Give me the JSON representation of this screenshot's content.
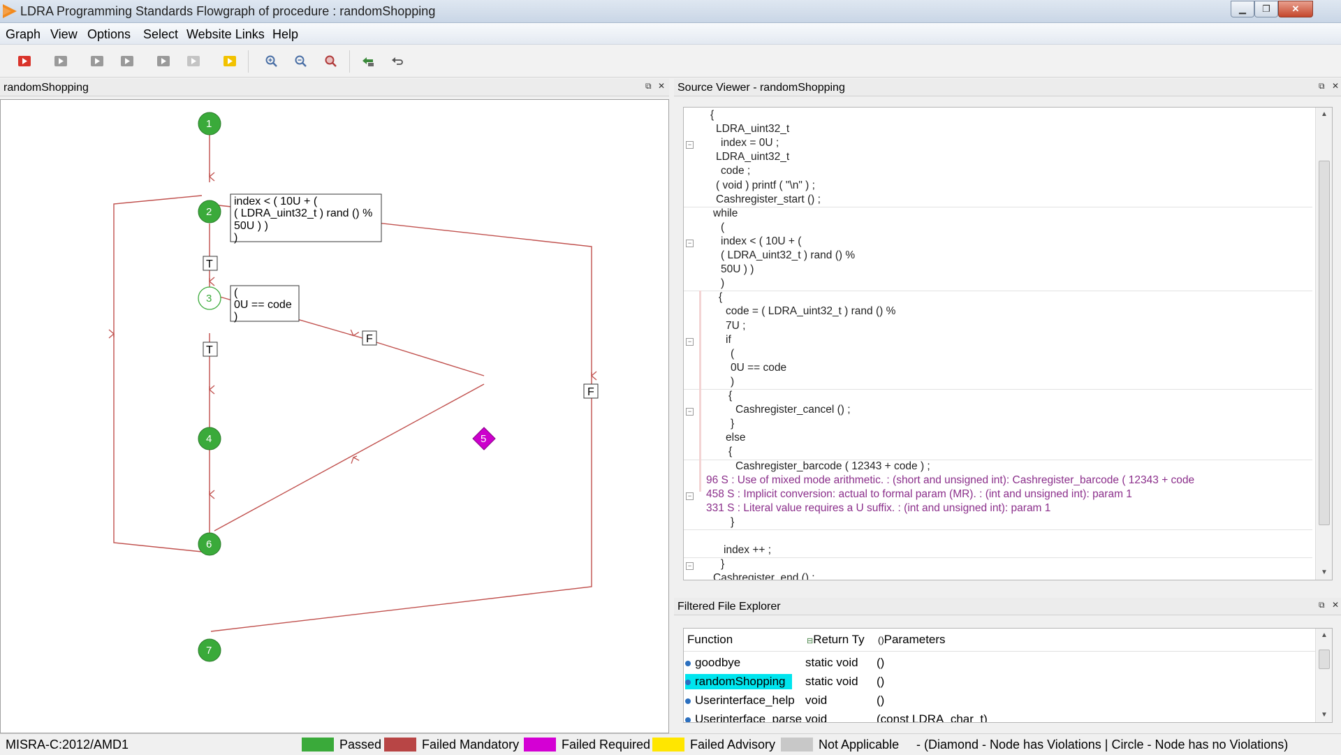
{
  "window": {
    "title": "LDRA Programming Standards Flowgraph of procedure : randomShopping",
    "minimize_icon": "minimize-icon",
    "maximize_icon": "maximize-icon",
    "close_icon": "close-icon"
  },
  "menu": [
    "Graph",
    "View",
    "Options",
    "Select",
    "Website Links",
    "Help"
  ],
  "toolbar_icons": [
    "play-red-icon",
    "play-gray-icon",
    "play-gray-icon",
    "play-gray-icon",
    "play-gray-icon",
    "play-gray-icon",
    "play-yellow-icon",
    "zoom-in-icon",
    "zoom-out-icon",
    "zoom-fit-icon",
    "back-green-icon",
    "undo-icon"
  ],
  "graph_panel": {
    "title": "randomShopping",
    "nodes": [
      {
        "id": "1",
        "status": "passed",
        "shape": "circle"
      },
      {
        "id": "2",
        "status": "passed",
        "shape": "circle"
      },
      {
        "id": "3",
        "status": "not-applicable",
        "shape": "circle"
      },
      {
        "id": "4",
        "status": "passed",
        "shape": "circle"
      },
      {
        "id": "5",
        "status": "failed-required",
        "shape": "diamond"
      },
      {
        "id": "6",
        "status": "passed",
        "shape": "circle"
      },
      {
        "id": "7",
        "status": "passed",
        "shape": "circle"
      }
    ],
    "cond1": [
      "index < ( 10U + (",
      "( LDRA_uint32_t ) rand () %",
      "50U ) )",
      ")"
    ],
    "cond2": [
      "(",
      "0U == code",
      ")"
    ],
    "true_label": "T",
    "false_label": "F"
  },
  "source_panel": {
    "title": "Source Viewer - randomShopping",
    "lines": [
      {
        "text": "{",
        "indent": 38,
        "fold": false,
        "viol": false
      },
      {
        "text": "LDRA_uint32_t",
        "indent": 46,
        "fold": false,
        "viol": false
      },
      {
        "text": "index = 0U ;",
        "indent": 53,
        "fold": true,
        "viol": false
      },
      {
        "text": "LDRA_uint32_t",
        "indent": 46,
        "fold": false,
        "viol": false
      },
      {
        "text": "code ;",
        "indent": 53,
        "fold": false,
        "viol": false
      },
      {
        "text": "( void ) printf ( \"\\n\" ) ;",
        "indent": 46,
        "fold": false,
        "viol": false
      },
      {
        "text": "Cashregister_start () ;",
        "indent": 46,
        "fold": false,
        "viol": false
      },
      {
        "text": "while",
        "indent": 42,
        "fold": false,
        "viol": false
      },
      {
        "text": "(",
        "indent": 53,
        "fold": false,
        "viol": false
      },
      {
        "text": "index < ( 10U + (",
        "indent": 53,
        "fold": true,
        "viol": false
      },
      {
        "text": "( LDRA_uint32_t ) rand () %",
        "indent": 53,
        "fold": false,
        "viol": false
      },
      {
        "text": "50U ) )",
        "indent": 53,
        "fold": false,
        "viol": false
      },
      {
        "text": ")",
        "indent": 53,
        "fold": false,
        "viol": false
      },
      {
        "text": "{",
        "indent": 50,
        "fold": false,
        "viol": false
      },
      {
        "text": "code = ( LDRA_uint32_t ) rand () %",
        "indent": 60,
        "fold": false,
        "viol": false
      },
      {
        "text": "7U ;",
        "indent": 60,
        "fold": false,
        "viol": false
      },
      {
        "text": "if",
        "indent": 60,
        "fold": true,
        "viol": false
      },
      {
        "text": "(",
        "indent": 67,
        "fold": false,
        "viol": false
      },
      {
        "text": "0U == code",
        "indent": 67,
        "fold": false,
        "viol": false
      },
      {
        "text": ")",
        "indent": 67,
        "fold": false,
        "viol": false
      },
      {
        "text": "{",
        "indent": 64,
        "fold": false,
        "viol": false
      },
      {
        "text": "Cashregister_cancel () ;",
        "indent": 74,
        "fold": true,
        "viol": false
      },
      {
        "text": "}",
        "indent": 67,
        "fold": false,
        "viol": false
      },
      {
        "text": "else",
        "indent": 60,
        "fold": false,
        "viol": false
      },
      {
        "text": "{",
        "indent": 64,
        "fold": false,
        "viol": false
      },
      {
        "text": "Cashregister_barcode ( 12343 + code ) ;",
        "indent": 74,
        "fold": false,
        "viol": false
      },
      {
        "text": "96 S : Use of mixed mode arithmetic. : (short and unsigned int): Cashregister_barcode ( 12343 + code",
        "indent": 32,
        "fold": false,
        "viol": true
      },
      {
        "text": "458 S : Implicit conversion: actual to formal param (MR). : (int and unsigned int): param 1",
        "indent": 32,
        "fold": true,
        "viol": true
      },
      {
        "text": "331 S : Literal value requires a U suffix. : (int and unsigned int): param 1",
        "indent": 32,
        "fold": false,
        "viol": true
      },
      {
        "text": "}",
        "indent": 67,
        "fold": false,
        "viol": false
      },
      {
        "text": "",
        "indent": 0,
        "fold": false,
        "viol": false
      },
      {
        "text": "index ++ ;",
        "indent": 57,
        "fold": false,
        "viol": false
      },
      {
        "text": "}",
        "indent": 53,
        "fold": true,
        "viol": false
      },
      {
        "text": "Cashregister_end () ;",
        "indent": 42,
        "fold": false,
        "viol": false
      }
    ]
  },
  "file_explorer": {
    "title": "Filtered File Explorer",
    "columns": [
      "Function",
      "Return Ty",
      "Parameters"
    ],
    "rows": [
      {
        "function": "goodbye",
        "return": "static void",
        "params": "()",
        "selected": false
      },
      {
        "function": "randomShopping",
        "return": "static void",
        "params": "()",
        "selected": true
      },
      {
        "function": "Userinterface_help",
        "return": "void",
        "params": "()",
        "selected": false
      },
      {
        "function": "Userinterface_parse",
        "return": "void",
        "params": "(const LDRA_char_t)",
        "selected": false
      }
    ]
  },
  "status_bar": {
    "standard": "MISRA-C:2012/AMD1",
    "legend": [
      {
        "label": "Passed",
        "color": "#3aaa3a"
      },
      {
        "label": "Failed Mandatory",
        "color": "#b84545"
      },
      {
        "label": "Failed Required",
        "color": "#d400d4"
      },
      {
        "label": "Failed Advisory",
        "color": "#ffe600"
      },
      {
        "label": "Not Applicable",
        "color": "#c8c8c8"
      }
    ],
    "note": "- (Diamond - Node has Violations | Circle - Node has no Violations)"
  },
  "colors": {
    "edge": "#c0504d",
    "passed": "#3aaa3a",
    "failed_required": "#cc00cc",
    "selection": "#00e5ee"
  }
}
